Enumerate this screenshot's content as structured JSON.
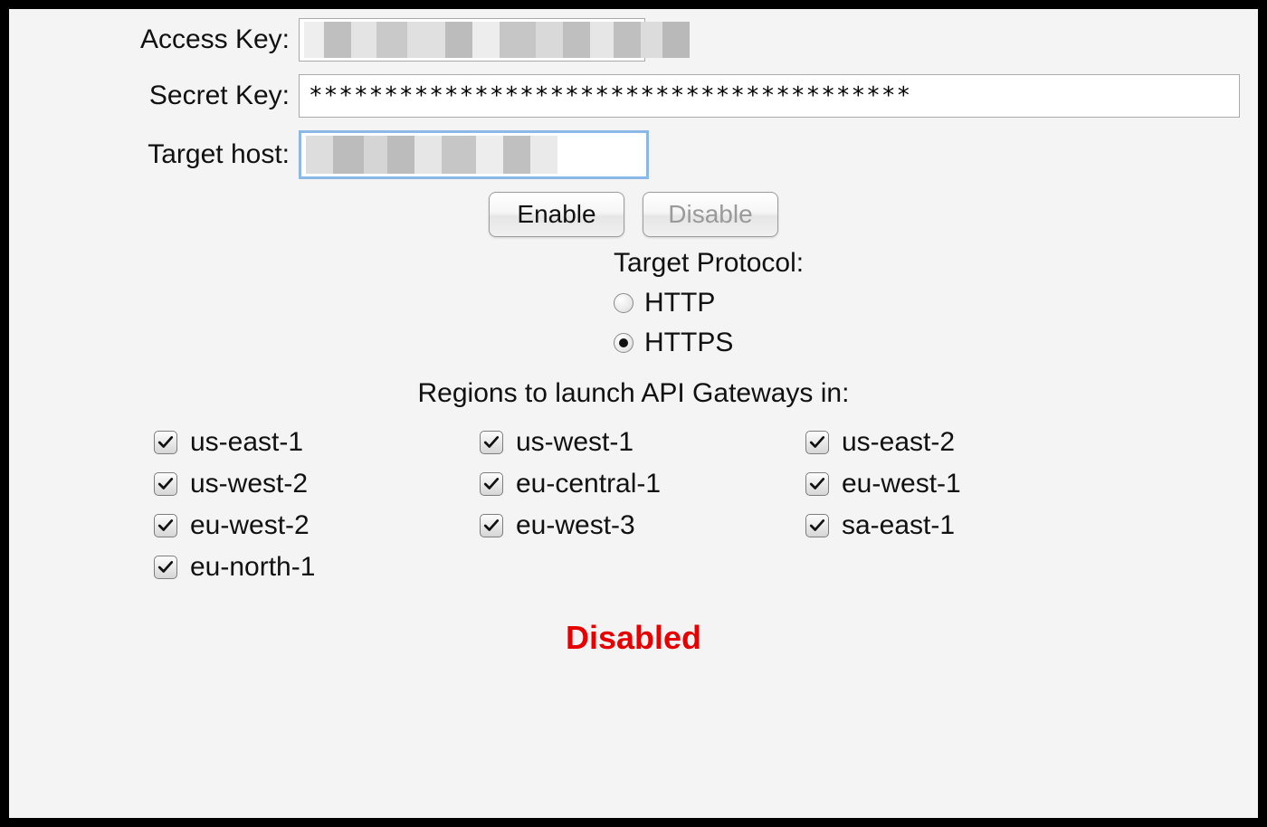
{
  "fields": {
    "access_key": {
      "label": "Access Key:",
      "value": "",
      "redacted": true
    },
    "secret_key": {
      "label": "Secret Key:",
      "value": "****************************************"
    },
    "target_host": {
      "label": "Target host:",
      "value": "",
      "redacted": true,
      "focused": true
    }
  },
  "buttons": {
    "enable": {
      "label": "Enable",
      "disabled": false
    },
    "disable": {
      "label": "Disable",
      "disabled": true
    }
  },
  "protocol": {
    "heading": "Target Protocol:",
    "options": [
      {
        "id": "http",
        "label": "HTTP",
        "selected": false
      },
      {
        "id": "https",
        "label": "HTTPS",
        "selected": true
      }
    ]
  },
  "regions": {
    "heading": "Regions to launch API Gateways in:",
    "items": [
      {
        "id": "us-east-1",
        "label": "us-east-1",
        "checked": true
      },
      {
        "id": "us-west-1",
        "label": "us-west-1",
        "checked": true
      },
      {
        "id": "us-east-2",
        "label": "us-east-2",
        "checked": true
      },
      {
        "id": "us-west-2",
        "label": "us-west-2",
        "checked": true
      },
      {
        "id": "eu-central-1",
        "label": "eu-central-1",
        "checked": true
      },
      {
        "id": "eu-west-1",
        "label": "eu-west-1",
        "checked": true
      },
      {
        "id": "eu-west-2",
        "label": "eu-west-2",
        "checked": true
      },
      {
        "id": "eu-west-3",
        "label": "eu-west-3",
        "checked": true
      },
      {
        "id": "sa-east-1",
        "label": "sa-east-1",
        "checked": true
      },
      {
        "id": "eu-north-1",
        "label": "eu-north-1",
        "checked": true
      }
    ]
  },
  "status": {
    "text": "Disabled",
    "color": "#e60000"
  }
}
